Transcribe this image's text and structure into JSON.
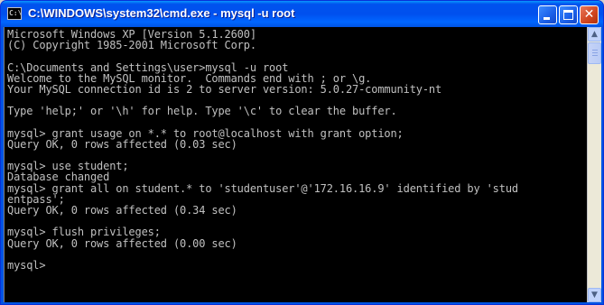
{
  "window": {
    "title": "C:\\WINDOWS\\system32\\cmd.exe - mysql -u root",
    "icon_text": "C:\\",
    "icon_name": "cmd-prompt-icon",
    "buttons": {
      "minimize": "minimize-icon",
      "maximize": "maximize-icon",
      "close": "close-icon",
      "close_glyph": "✕"
    }
  },
  "console": {
    "lines": [
      "Microsoft Windows XP [Version 5.1.2600]",
      "(C) Copyright 1985-2001 Microsoft Corp.",
      "",
      "C:\\Documents and Settings\\user>mysql -u root",
      "Welcome to the MySQL monitor.  Commands end with ; or \\g.",
      "Your MySQL connection id is 2 to server version: 5.0.27-community-nt",
      "",
      "Type 'help;' or '\\h' for help. Type '\\c' to clear the buffer.",
      "",
      "mysql> grant usage on *.* to root@localhost with grant option;",
      "Query OK, 0 rows affected (0.03 sec)",
      "",
      "mysql> use student;",
      "Database changed",
      "mysql> grant all on student.* to 'studentuser'@'172.16.16.9' identified by 'stud",
      "entpass';",
      "Query OK, 0 rows affected (0.34 sec)",
      "",
      "mysql> flush privileges;",
      "Query OK, 0 rows affected (0.00 sec)",
      "",
      "mysql>"
    ]
  },
  "scrollbar": {
    "up_glyph": "▲",
    "down_glyph": "▼",
    "position_fraction": 0.0
  },
  "colors": {
    "titlebar": "#0054e3",
    "console_bg": "#000000",
    "console_fg": "#c0c0c0",
    "close_button": "#d0451f"
  }
}
